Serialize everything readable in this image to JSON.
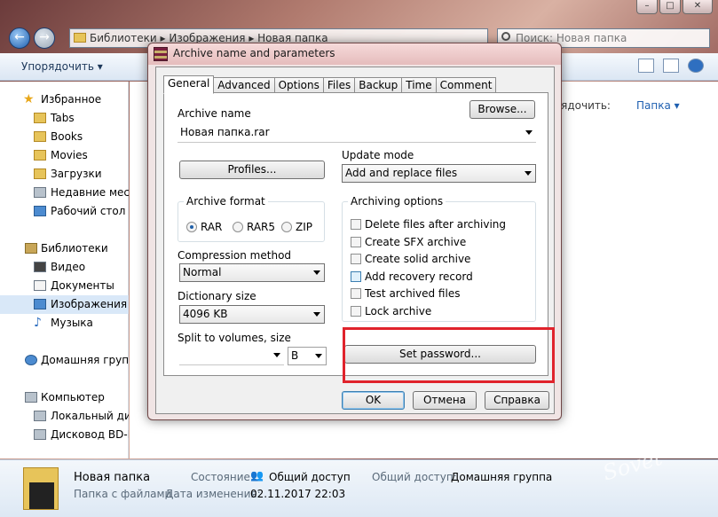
{
  "explorer": {
    "address": [
      "Библиотеки",
      "Изображения",
      "Новая папка"
    ],
    "search_placeholder": "Поиск: Новая папка",
    "organize": "Упорядочить",
    "sort_label": "Упорядочить:",
    "sort_value": "Папка",
    "sidebar": {
      "favorites": "Избранное",
      "fav_items": [
        "Tabs",
        "Books",
        "Movies",
        "Загрузки",
        "Недавние места",
        "Рабочий стол"
      ],
      "libraries": "Библиотеки",
      "lib_items": [
        "Видео",
        "Документы",
        "Изображения",
        "Музыка"
      ],
      "homegroup": "Домашняя группа",
      "computer": "Компьютер",
      "comp_items": [
        "Локальный диск",
        "Дисковод BD-RO"
      ]
    },
    "details": {
      "name": "Новая папка",
      "type": "Папка с файлами",
      "state_label": "Состояние:",
      "state_value": "Общий доступ",
      "modified_label": "Дата изменения:",
      "modified_value": "02.11.2017 22:03",
      "share_label": "Общий доступ:",
      "share_value": "Домашняя группа"
    },
    "watermark": "club Sovet"
  },
  "dialog": {
    "title": "Archive name and parameters",
    "tabs": [
      "General",
      "Advanced",
      "Options",
      "Files",
      "Backup",
      "Time",
      "Comment"
    ],
    "active_tab": "General",
    "archive_name_label": "Archive name",
    "archive_name_value": "Новая папка.rar",
    "browse": "Browse...",
    "profiles": "Profiles...",
    "update_mode_label": "Update mode",
    "update_mode_value": "Add and replace files",
    "archive_format_label": "Archive format",
    "formats": [
      "RAR",
      "RAR5",
      "ZIP"
    ],
    "selected_format": "RAR",
    "compression_label": "Compression method",
    "compression_value": "Normal",
    "dictionary_label": "Dictionary size",
    "dictionary_value": "4096 KB",
    "split_label": "Split to volumes, size",
    "split_value": "",
    "split_unit": "B",
    "archiving_options_label": "Archiving options",
    "options": [
      "Delete files after archiving",
      "Create SFX archive",
      "Create solid archive",
      "Add recovery record",
      "Test archived files",
      "Lock archive"
    ],
    "set_password": "Set password...",
    "ok": "OK",
    "cancel": "Отмена",
    "help": "Справка"
  }
}
